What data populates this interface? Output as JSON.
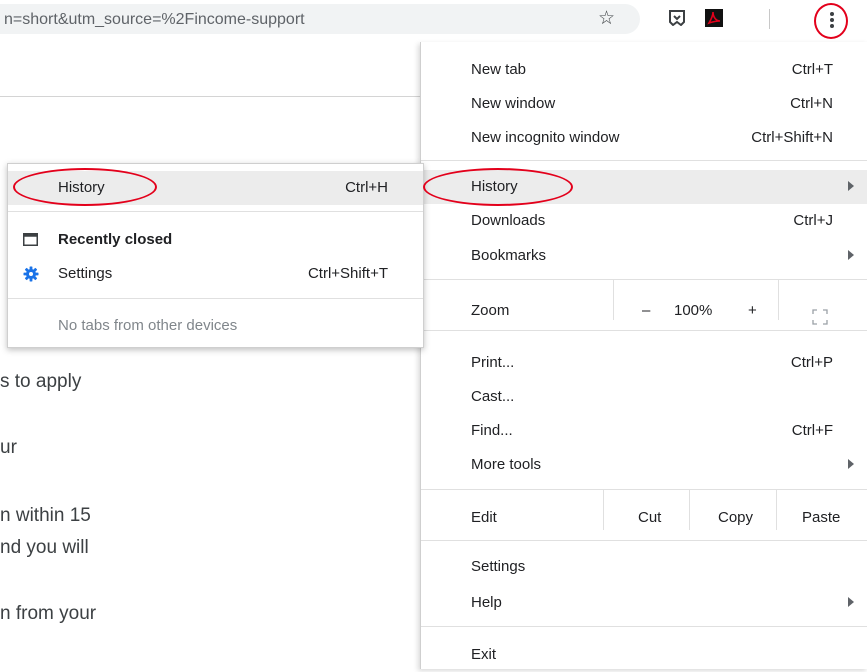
{
  "toolbar": {
    "url": "n=short&utm_source=%2Fincome-support",
    "star_glyph": "☆",
    "icons": [
      "star-icon",
      "ghostery-extension-icon",
      "adobe-acrobat-icon",
      "more-menu-icon"
    ],
    "accent_color": "#e3001b"
  },
  "page": {
    "lines": [
      "s to apply",
      "ur",
      "n within 15",
      "nd you will",
      "n from your"
    ]
  },
  "menu": {
    "new_tab": {
      "label": "New tab",
      "shortcut": "Ctrl+T"
    },
    "new_window": {
      "label": "New window",
      "shortcut": "Ctrl+N"
    },
    "new_incognito": {
      "label": "New incognito window",
      "shortcut": "Ctrl+Shift+N"
    },
    "history": {
      "label": "History"
    },
    "downloads": {
      "label": "Downloads",
      "shortcut": "Ctrl+J"
    },
    "bookmarks": {
      "label": "Bookmarks"
    },
    "zoom": {
      "label": "Zoom",
      "minus": "–",
      "level": "100%",
      "plus": "+"
    },
    "print": {
      "label": "Print...",
      "shortcut": "Ctrl+P"
    },
    "cast": {
      "label": "Cast..."
    },
    "find": {
      "label": "Find...",
      "shortcut": "Ctrl+F"
    },
    "more_tools": {
      "label": "More tools"
    },
    "edit": {
      "label": "Edit",
      "cut": "Cut",
      "copy": "Copy",
      "paste": "Paste"
    },
    "settings": {
      "label": "Settings"
    },
    "help": {
      "label": "Help"
    },
    "exit": {
      "label": "Exit"
    }
  },
  "submenu": {
    "history": {
      "label": "History",
      "shortcut": "Ctrl+H"
    },
    "recently_closed": {
      "label": "Recently closed"
    },
    "settings": {
      "label": "Settings",
      "shortcut": "Ctrl+Shift+T"
    },
    "no_tabs": {
      "label": "No tabs from other devices"
    }
  }
}
